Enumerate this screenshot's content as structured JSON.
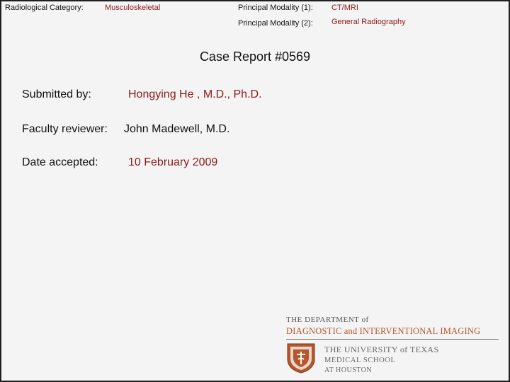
{
  "header": {
    "radiological_category_label": "Radiological Category:",
    "radiological_category_value": "Musculoskeletal",
    "modality1_label": "Principal Modality (1):",
    "modality1_value": "CT/MRI",
    "modality2_label": "Principal Modality (2):",
    "modality2_value": "General Radiography"
  },
  "title": "Case Report #0569",
  "fields": {
    "submitted_by_label": "Submitted by:",
    "submitted_by_value": "Hongying He , M.D., Ph.D.",
    "faculty_reviewer_label": "Faculty reviewer:",
    "faculty_reviewer_value": "John Madewell, M.D.",
    "date_accepted_label": "Date accepted:",
    "date_accepted_value": "10 February 2009"
  },
  "logo": {
    "line1": "THE DEPARTMENT of",
    "line2": "DIAGNOSTIC and INTERVENTIONAL IMAGING",
    "line3": "THE UNIVERSITY of TEXAS",
    "line4": "MEDICAL SCHOOL",
    "line5": "AT HOUSTON"
  },
  "colors": {
    "accent_value": "#8b1a1a",
    "logo_orange": "#b5562b",
    "background": "#f4f4f4"
  }
}
